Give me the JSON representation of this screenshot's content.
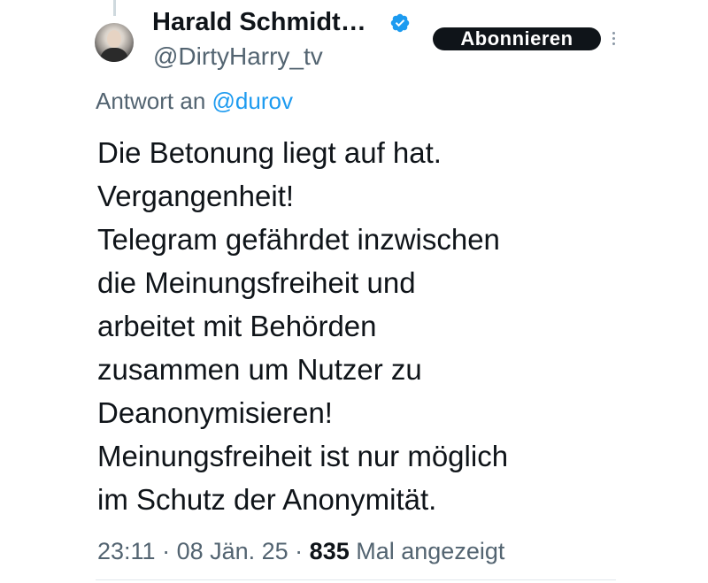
{
  "author": {
    "display_name": "Harald Schmidt…",
    "handle": "@DirtyHarry_tv",
    "verified": true
  },
  "subscribe_label": "Abonnieren",
  "reply": {
    "prefix": "Antwort an",
    "mention": "@durov"
  },
  "tweet": {
    "text": "Die Betonung liegt auf hat.\nVergangenheit!\nTelegram gefährdet inzwischen\ndie Meinungsfreiheit und\narbeitet mit Behörden\nzusammen um Nutzer zu\nDeanonymisieren!\nMeinungsfreiheit ist nur möglich\nim Schutz der Anonymität."
  },
  "meta": {
    "time": "23:11",
    "separator": " · ",
    "date": "08 Jän. 25",
    "views_count": "835",
    "views_label": "Mal angezeigt"
  },
  "icons": {
    "verified": "verified-badge-icon",
    "more": "more-options-icon"
  },
  "colors": {
    "accent": "#1d9bf0",
    "text_primary": "#0f1419",
    "text_secondary": "#536471",
    "button_bg": "#0f1419"
  }
}
